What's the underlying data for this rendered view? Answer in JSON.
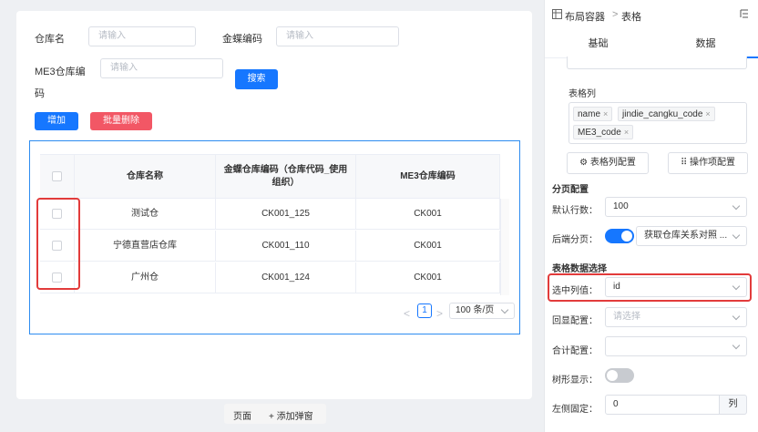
{
  "canvas": {
    "search_form": {
      "warehouse_name_label": "仓库名",
      "warehouse_name_placeholder": "请输入",
      "kingdee_code_label": "金蝶编码",
      "kingdee_code_placeholder": "请输入",
      "me3_code_label_line1": "ME3仓库编",
      "me3_code_label_line2": "码",
      "me3_code_placeholder": "请输入",
      "search_button": "搜索"
    },
    "toolbar": {
      "add_button": "增加",
      "batch_delete_button": "批量删除"
    },
    "table": {
      "columns": [
        "仓库名称",
        "金蝶仓库编码（仓库代码_使用组织）",
        "ME3仓库编码"
      ],
      "rows": [
        [
          "测试仓",
          "CK001_125",
          "CK001"
        ],
        [
          "宁德直营店仓库",
          "CK001_110",
          "CK001"
        ],
        [
          "广州仓",
          "CK001_124",
          "CK001"
        ]
      ]
    },
    "pagination": {
      "prev": "<",
      "current_page": "1",
      "next": ">",
      "page_size": "100 条/页"
    }
  },
  "bottom_bar": {
    "page_label": "页面",
    "add_dialog_label": "+ 添加弹窗"
  },
  "panel": {
    "breadcrumb": {
      "parent": "布局容器",
      "separator": ">",
      "current": "表格"
    },
    "tabs": [
      "基础",
      "数据"
    ],
    "active_tab": "数据",
    "table_columns_label": "表格列",
    "column_tags": [
      "name",
      "jindie_cangku_code",
      "ME3_code"
    ],
    "table_columns_config_button": "表格列配置",
    "action_items_config_button": "操作项配置",
    "pagination_section": "分页配置",
    "default_rows_label": "默认行数：",
    "default_rows_value": "100",
    "backend_paging_label": "后端分页：",
    "backend_paging_enabled": true,
    "backend_paging_source": "获取仓库关系对照 ...",
    "data_selection_section": "表格数据选择",
    "selected_column_label": "选中列值：",
    "selected_column_value": "id",
    "echo_config_label": "回显配置：",
    "echo_config_placeholder": "请选择",
    "sum_config_label": "合计配置：",
    "tree_display_label": "树形显示：",
    "tree_display_enabled": false,
    "left_fixed_label": "左侧固定：",
    "left_fixed_value": "0",
    "left_fixed_unit": "列"
  },
  "colors": {
    "primary": "#1677ff",
    "danger": "#f25765",
    "highlight": "#e23b3b"
  }
}
